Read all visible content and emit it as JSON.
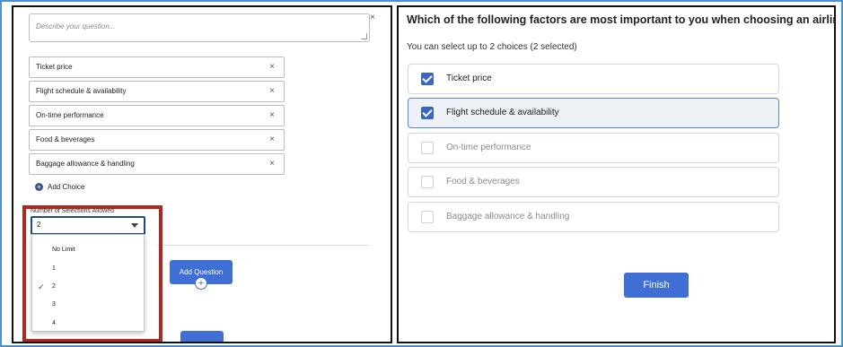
{
  "editor": {
    "description_placeholder": "Describe your question...",
    "close_glyph": "×",
    "choices": [
      {
        "label": "Ticket price"
      },
      {
        "label": "Flight schedule & availability"
      },
      {
        "label": "On-time performance"
      },
      {
        "label": "Food & beverages"
      },
      {
        "label": "Baggage allowance & handling"
      }
    ],
    "remove_glyph": "×",
    "add_choice_icon": "plus-circle-icon",
    "add_choice_label": "Add Choice",
    "selections_label": "Number of Selections Allowed",
    "selections_value": "2",
    "dropdown_options": [
      {
        "label": "No Limit",
        "checked": false
      },
      {
        "label": "1",
        "checked": false
      },
      {
        "label": "2",
        "checked": true
      },
      {
        "label": "3",
        "checked": false
      },
      {
        "label": "4",
        "checked": false
      }
    ],
    "check_glyph": "✓",
    "add_question_label": "Add Question",
    "add_question_icon": "plus-circle-icon",
    "highlight_color": "#b1271b"
  },
  "preview": {
    "question": "Which of the following factors are most important to you when choosing an airline?",
    "hint": "You can select up to 2 choices (2 selected)",
    "options": [
      {
        "label": "Ticket price",
        "checked": true
      },
      {
        "label": "Flight schedule & availability",
        "checked": true
      },
      {
        "label": "On-time performance",
        "checked": false
      },
      {
        "label": "Food & beverages",
        "checked": false
      },
      {
        "label": "Baggage allowance & handling",
        "checked": false
      }
    ],
    "finish_label": "Finish",
    "accent_color": "#3f6ed4"
  }
}
